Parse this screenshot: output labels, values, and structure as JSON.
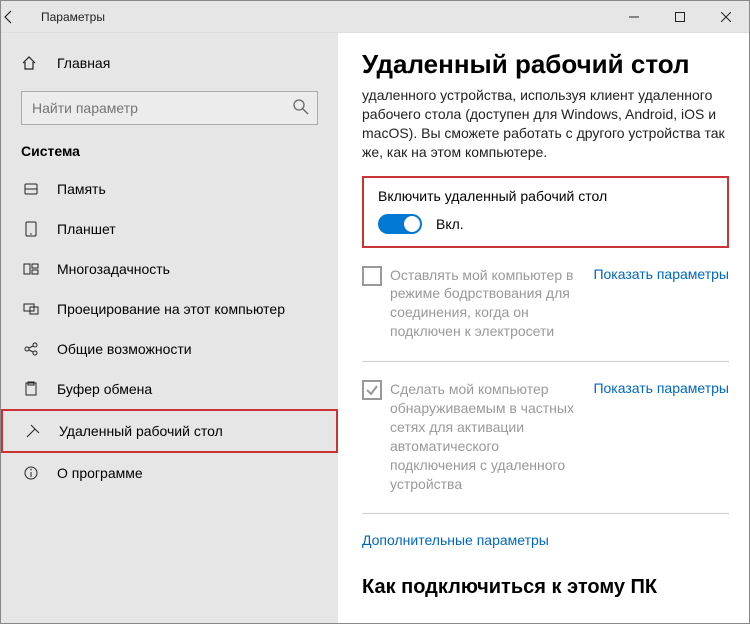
{
  "titlebar": {
    "title": "Параметры"
  },
  "sidebar": {
    "home": "Главная",
    "search_placeholder": "Найти параметр",
    "category": "Система",
    "items": [
      {
        "label": "Память"
      },
      {
        "label": "Планшет"
      },
      {
        "label": "Многозадачность"
      },
      {
        "label": "Проецирование на этот компьютер"
      },
      {
        "label": "Общие возможности"
      },
      {
        "label": "Буфер обмена"
      },
      {
        "label": "Удаленный рабочий стол"
      },
      {
        "label": "О программе"
      }
    ]
  },
  "content": {
    "heading": "Удаленный рабочий стол",
    "description": "удаленного устройства, используя клиент удаленного рабочего стола (доступен для Windows, Android, iOS и macOS). Вы сможете работать с другого устройства так же, как на этом компьютере.",
    "toggle": {
      "title": "Включить удаленный рабочий стол",
      "state_label": "Вкл."
    },
    "option1": {
      "text": "Оставлять мой компьютер в режиме бодрствования для соединения, когда он подключен к электросети",
      "link": "Показать параметры"
    },
    "option2": {
      "text": "Сделать мой компьютер обнаруживаемым в частных сетях для активации автоматического подключения с удаленного устройства",
      "link": "Показать параметры"
    },
    "more_link": "Дополнительные параметры",
    "subheading": "Как подключиться к этому ПК"
  }
}
